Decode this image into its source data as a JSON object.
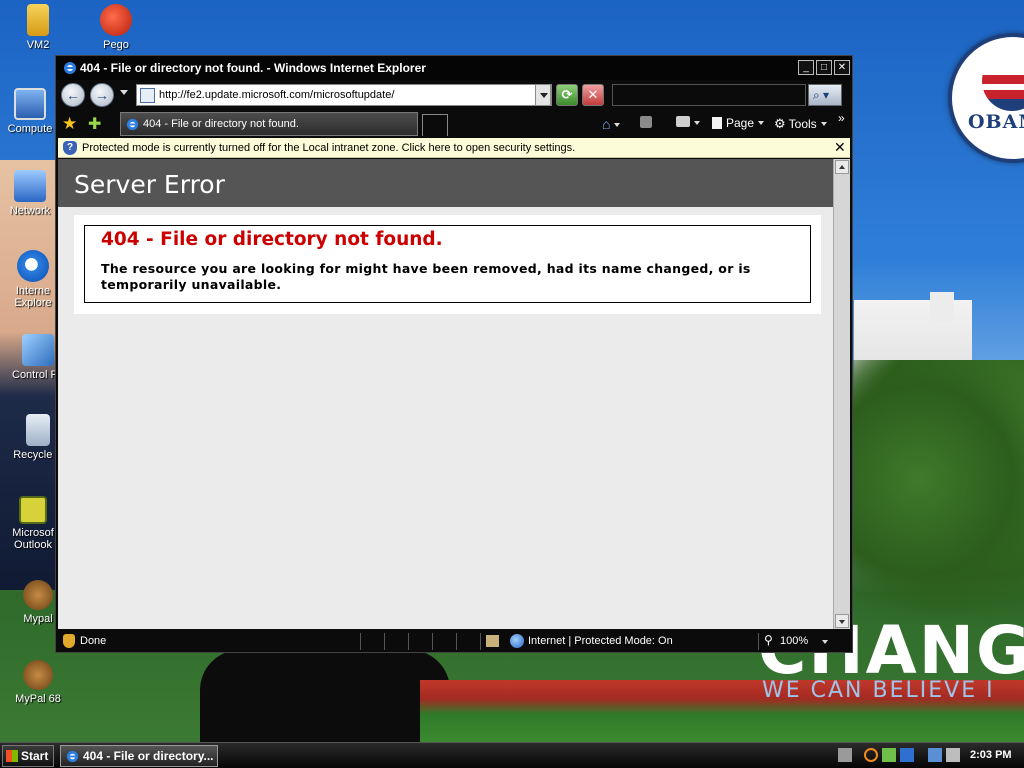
{
  "desktop": {
    "icons": [
      {
        "label": "VM2"
      },
      {
        "label": "Pego"
      },
      {
        "label": "Compute"
      },
      {
        "label": "Network"
      },
      {
        "label": "Interne Explore"
      },
      {
        "label": "Control Pa"
      },
      {
        "label": "Recycle B"
      },
      {
        "label": "Microsof Outlook"
      },
      {
        "label": "Mypal"
      },
      {
        "label": "MyPal 68"
      }
    ],
    "wallpaper": {
      "logo_text": "OBAM",
      "headline": "CHANGE",
      "slogan": "WE CAN BELIEVE I"
    }
  },
  "window": {
    "title": "404 - File or directory not found. - Windows Internet Explorer",
    "controls": {
      "minimize": "_",
      "maximize": "□",
      "close": "✕"
    },
    "address_url": "http://fe2.update.microsoft.com/microsoftupdate/",
    "tab_label": "404 - File or directory not found.",
    "toolbar": {
      "page": "Page",
      "tools": "Tools",
      "more": "»"
    },
    "infobar": {
      "message": "Protected mode is currently turned off for the Local intranet zone.  Click here to open security settings.",
      "close": "✕"
    },
    "page": {
      "header": "Server Error",
      "error_title": "404 - File or directory not found.",
      "error_message": "The resource you are looking for might have been removed, had its name changed, or is temporarily unavailable."
    },
    "status": {
      "text": "Done",
      "zone": "Internet | Protected Mode: On",
      "zoom": "100%"
    }
  },
  "taskbar": {
    "start_label": "Start",
    "active_task": "404 - File or directory...",
    "clock": "2:03 PM"
  },
  "icons": {
    "back": "back-arrow-icon",
    "forward": "forward-arrow-icon",
    "refresh": "refresh-icon",
    "stop": "stop-icon",
    "search": "search-icon",
    "home": "home-icon",
    "feeds": "rss-feed-icon",
    "print": "printer-icon",
    "favorites": "star-icon",
    "add_favorites": "add-favorites-icon",
    "security": "shield-icon"
  },
  "colors": {
    "error_red": "#cc0000",
    "header_gray": "#555555",
    "content_bg": "#ebebeb",
    "infobar_bg": "#fcfcd8"
  }
}
